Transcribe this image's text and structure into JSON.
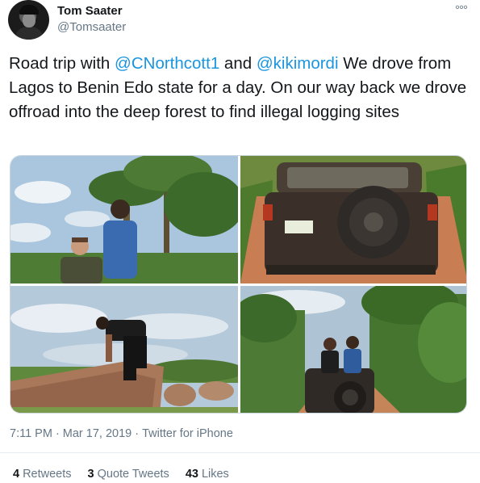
{
  "author": {
    "display_name": "Tom Saater",
    "handle": "@Tomsaater"
  },
  "menu_label": "°°°",
  "tweet": {
    "text_1": "Road trip with ",
    "mention_1": "@CNorthcott1",
    "text_2": " and ",
    "mention_2": "@kikimordi",
    "text_3": " We drove from Lagos to Benin Edo state for a day. On our way back we drove offroad into the deep forest to find illegal logging sites"
  },
  "media": {
    "photos": [
      "photo-two-men-palm-trees",
      "photo-suv-rear-dirt-road",
      "photo-man-climbing-logs",
      "photo-men-on-suv-forest-road"
    ]
  },
  "meta": {
    "time": "7:11 PM",
    "separator": "·",
    "date": "Mar 17, 2019",
    "source": "Twitter for iPhone"
  },
  "stats": {
    "retweets_count": "4",
    "retweets_label": "Retweets",
    "quote_count": "3",
    "quote_label": "Quote Tweets",
    "likes_count": "43",
    "likes_label": "Likes"
  },
  "colors": {
    "link": "#1b95e0",
    "secondary_text": "#657786",
    "primary_text": "#14171a"
  }
}
